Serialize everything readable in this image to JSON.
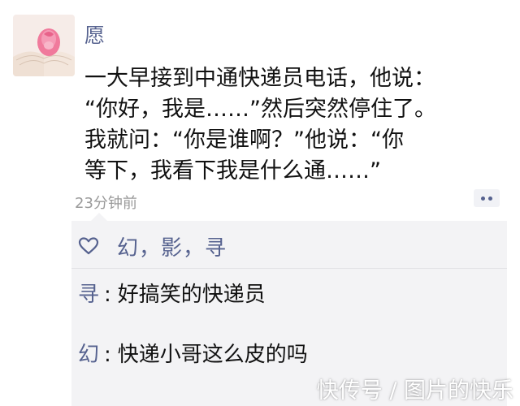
{
  "post": {
    "username": "愿",
    "text_lines": [
      "一大早接到中通快递员电话，他说：",
      "“你好，我是……”然后突然停住了。",
      "我就问：“你是谁啊？”他说：“你",
      "等下，我看下我是什么通……”"
    ],
    "timestamp": "23分钟前"
  },
  "interactions": {
    "likers": "幻，影，寻",
    "comments": [
      {
        "name": "寻",
        "separator": ":",
        "text": "好搞笑的快递员"
      },
      {
        "name": "幻",
        "separator": ":",
        "text": "快递小哥这么皮的吗"
      }
    ]
  },
  "watermark": "快传号 / 图片的快乐",
  "colors": {
    "link": "#56628f",
    "comment_bg": "#f3f3f5"
  }
}
